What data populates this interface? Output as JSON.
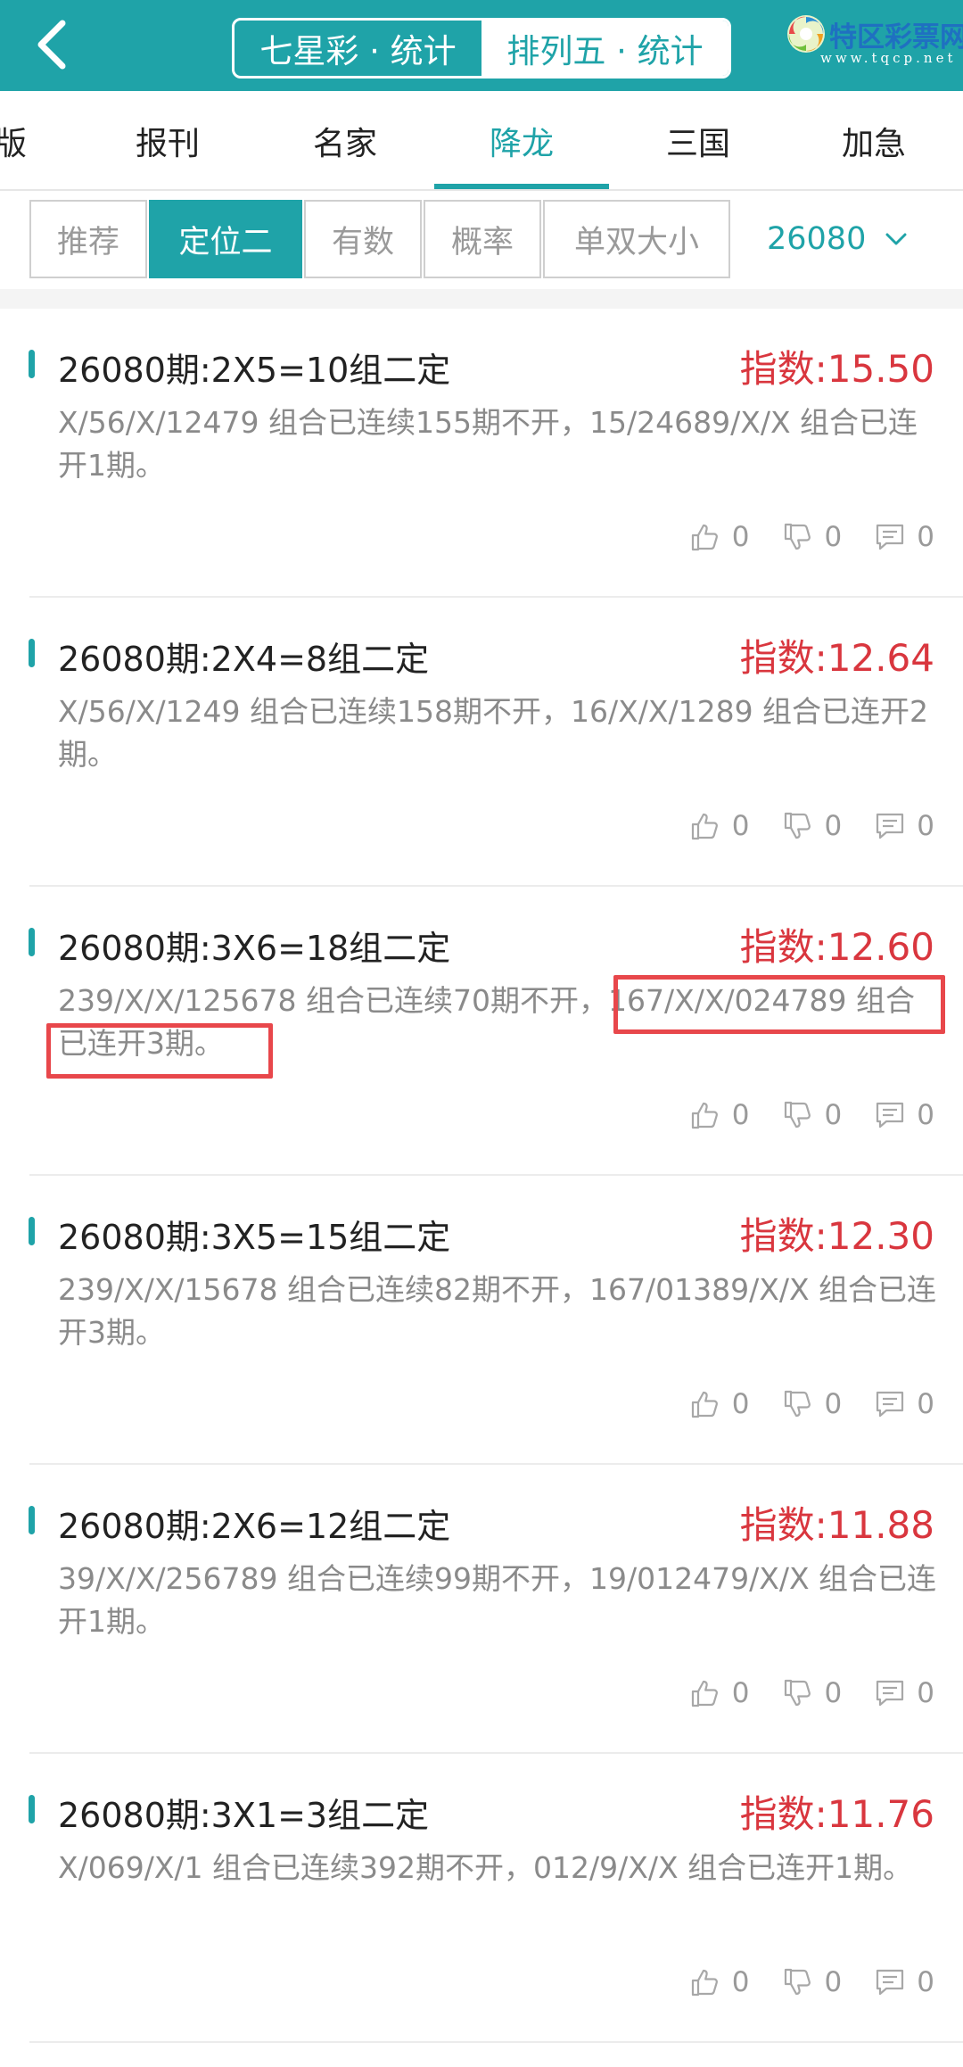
{
  "header": {
    "segments": [
      "七星彩 · 统计",
      "排列五 · 统计"
    ],
    "active_segment": 1,
    "logo_text": "特区彩票网",
    "logo_url": "www.tqcp.net"
  },
  "tabs": [
    "版",
    "报刊",
    "名家",
    "降龙",
    "三国",
    "加急"
  ],
  "active_tab": 3,
  "filters": [
    "推荐",
    "定位二",
    "有数",
    "概率",
    "单双大小"
  ],
  "active_filter": 1,
  "issue_selector": {
    "value": "26080"
  },
  "cards": [
    {
      "title": "26080期:2X5=10组二定",
      "index": "指数:15.50",
      "desc": "X/56/X/12479 组合已连续155期不开，15/24689/X/X 组合已连开1期。",
      "likes": "0",
      "dislikes": "0",
      "comments": "0"
    },
    {
      "title": "26080期:2X4=8组二定",
      "index": "指数:12.64",
      "desc": "X/56/X/1249 组合已连续158期不开，16/X/X/1289 组合已连开2期。",
      "likes": "0",
      "dislikes": "0",
      "comments": "0"
    },
    {
      "title": "26080期:3X6=18组二定",
      "index": "指数:12.60",
      "desc": "239/X/X/125678 组合已连续70期不开，167/X/X/024789 组合已连开3期。",
      "likes": "0",
      "dislikes": "0",
      "comments": "0"
    },
    {
      "title": "26080期:3X5=15组二定",
      "index": "指数:12.30",
      "desc": "239/X/X/15678 组合已连续82期不开，167/01389/X/X 组合已连开3期。",
      "likes": "0",
      "dislikes": "0",
      "comments": "0"
    },
    {
      "title": "26080期:2X6=12组二定",
      "index": "指数:11.88",
      "desc": "39/X/X/256789 组合已连续99期不开，19/012479/X/X 组合已连开1期。",
      "likes": "0",
      "dislikes": "0",
      "comments": "0"
    },
    {
      "title": "26080期:3X1=3组二定",
      "index": "指数:11.76",
      "desc": "X/069/X/1 组合已连续392期不开，012/9/X/X 组合已连开1期。",
      "likes": "0",
      "dislikes": "0",
      "comments": "0"
    }
  ],
  "colors": {
    "accent": "#1fa3a8",
    "index_red": "#d9363e",
    "highlight": "#e8474b"
  }
}
